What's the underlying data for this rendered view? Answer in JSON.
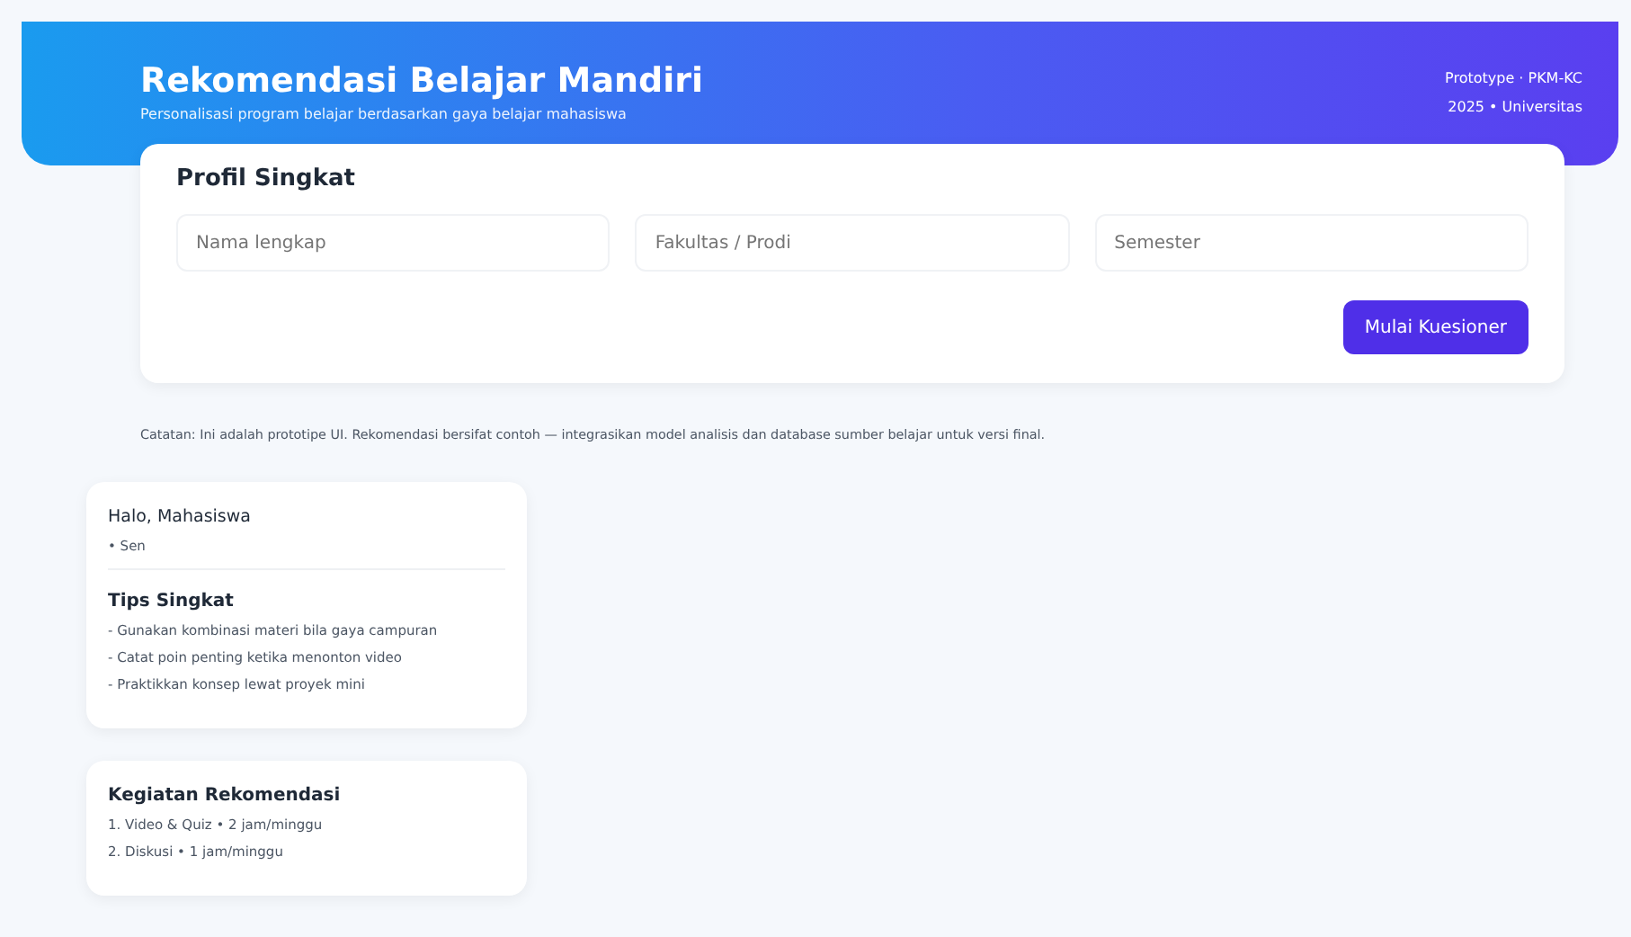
{
  "header": {
    "title": "Rekomendasi Belajar Mandiri",
    "subtitle": "Personalisasi program belajar berdasarkan gaya belajar mahasiswa",
    "meta": [
      "Prototype · PKM-KC",
      "2025 • Universitas"
    ]
  },
  "profile": {
    "title": "Profil Singkat",
    "fields": [
      {
        "placeholder": "Nama lengkap"
      },
      {
        "placeholder": "Fakultas / Prodi"
      },
      {
        "placeholder": "Semester"
      }
    ],
    "button": "Mulai Kuesioner"
  },
  "note": "Catatan: Ini adalah prototipe UI. Rekomendasi bersifat contoh — integrasikan model analisis dan database sumber belajar untuk versi final.",
  "greeting": {
    "title": "Halo, Mahasiswa",
    "sub": "• Sen"
  },
  "tips": {
    "title": "Tips Singkat",
    "items": [
      "- Gunakan kombinasi materi bila gaya campuran",
      "- Catat poin penting ketika menonton video",
      "- Praktikkan konsep lewat proyek mini"
    ]
  },
  "activities": {
    "title": "Kegiatan Rekomendasi",
    "items": [
      "1. Video & Quiz • 2 jam/minggu",
      "2. Diskusi • 1 jam/minggu"
    ]
  }
}
